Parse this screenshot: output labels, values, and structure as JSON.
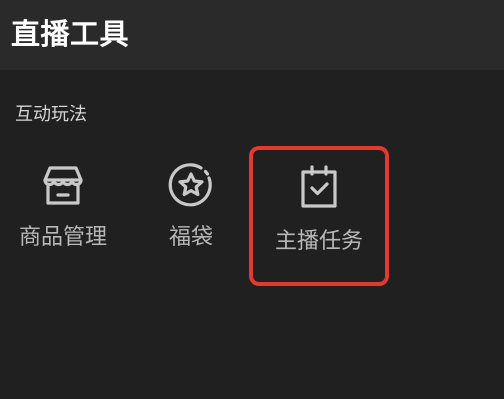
{
  "header": {
    "title": "直播工具"
  },
  "section": {
    "title": "互动玩法"
  },
  "tools": [
    {
      "label": "商品管理",
      "icon": "store-icon"
    },
    {
      "label": "福袋",
      "icon": "star-badge-icon"
    },
    {
      "label": "主播任务",
      "icon": "task-calendar-icon",
      "highlighted": true
    }
  ],
  "colors": {
    "background": "#202020",
    "header_background": "#2a2a2a",
    "text_primary": "#ffffff",
    "text_secondary": "#b8b8b8",
    "highlight_border": "#e23a2e"
  }
}
